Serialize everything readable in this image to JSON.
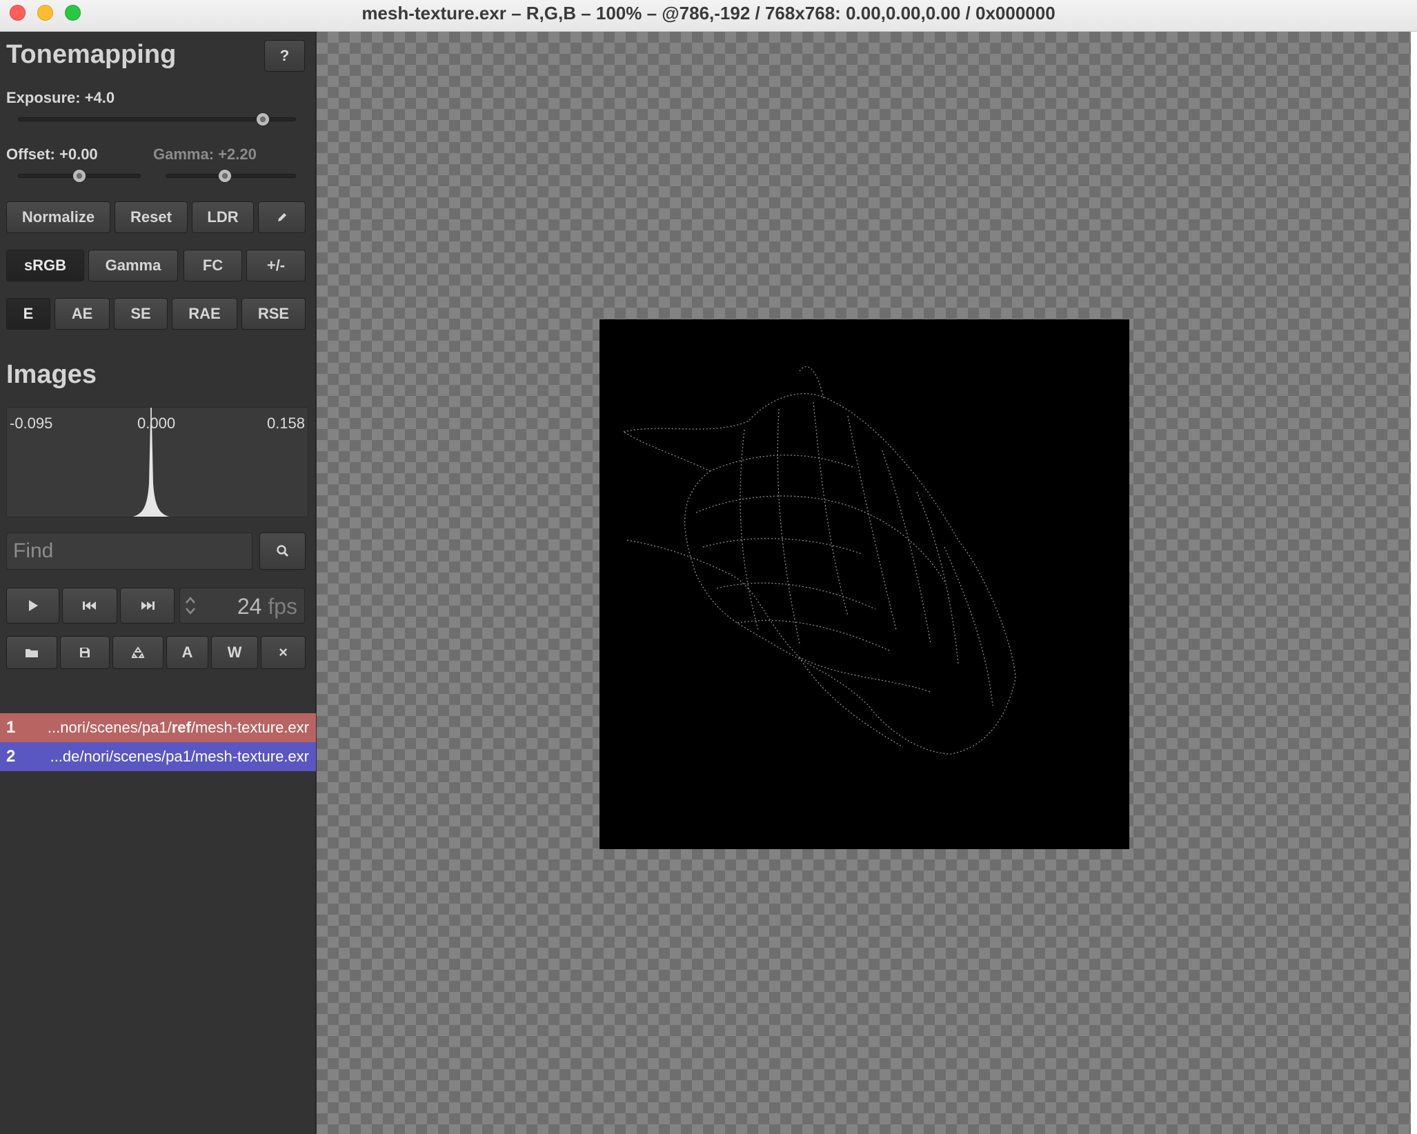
{
  "window": {
    "title": "mesh-texture.exr – R,G,B – 100% – @786,-192 / 768x768: 0.00,0.00,0.00 / 0x000000"
  },
  "tonemapping": {
    "heading": "Tonemapping",
    "help_label": "?",
    "exposure_label": "Exposure: +4.0",
    "exposure_fraction": 0.9,
    "offset_label": "Offset: +0.00",
    "offset_fraction": 0.5,
    "gamma_label": "Gamma: +2.20",
    "gamma_fraction": 0.45,
    "row1_buttons": [
      "Normalize",
      "Reset",
      "LDR"
    ],
    "row1_icon": "pencil-icon",
    "row2_buttons": [
      "sRGB",
      "Gamma",
      "FC",
      "+/-"
    ],
    "row2_active": "sRGB",
    "row3_buttons": [
      "E",
      "AE",
      "SE",
      "RAE",
      "RSE"
    ],
    "row3_active": "E"
  },
  "images": {
    "heading": "Images",
    "histogram": {
      "min": "-0.095",
      "mid": "0.000",
      "max": "0.158"
    },
    "search_placeholder": "Find",
    "search_icon": "search-icon",
    "playback": {
      "icons": [
        "play-icon",
        "skip-back-icon",
        "skip-forward-icon"
      ],
      "fps_value": "24",
      "fps_unit": "fps"
    },
    "file_actions": {
      "icons": [
        "folder-icon",
        "save-icon",
        "reload-icon"
      ],
      "labels": [
        "A",
        "W"
      ],
      "close_label": "×"
    },
    "list": [
      {
        "index": "1",
        "path_prefix": "...nori/scenes/pa1/",
        "path_bold": "ref",
        "path_suffix": "/mesh-texture.exr"
      },
      {
        "index": "2",
        "path": "...de/nori/scenes/pa1/mesh-texture.exr"
      }
    ]
  },
  "colors": {
    "reference_image": "#b86463",
    "current_image": "#5a56c2",
    "sidebar_bg": "#333333"
  },
  "viewer": {
    "image_size": "768x768",
    "zoom": "100%"
  }
}
